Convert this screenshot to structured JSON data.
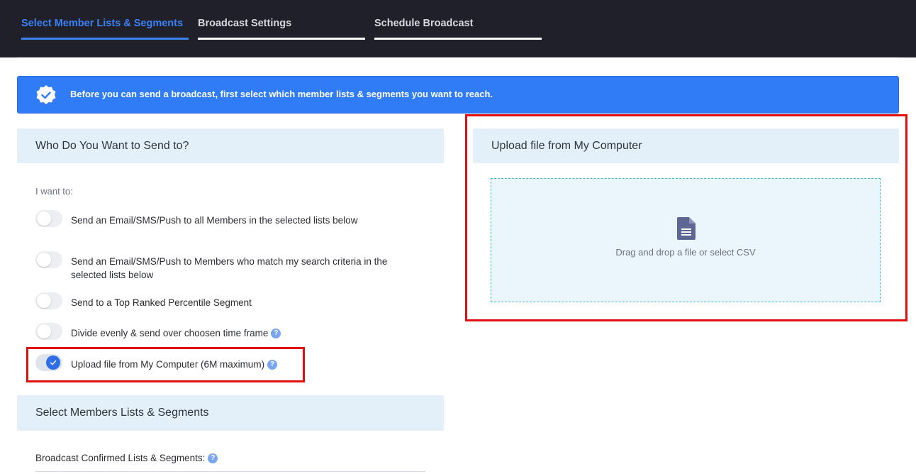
{
  "tabs": [
    {
      "label": "Select Member Lists & Segments",
      "active": true
    },
    {
      "label": "Broadcast Settings",
      "active": false
    },
    {
      "label": "Schedule Broadcast",
      "active": false
    }
  ],
  "banner": {
    "icon": "badge-check-icon",
    "text": "Before you can send a broadcast, first select which member lists & segments you want to reach."
  },
  "who": {
    "title": "Who Do You Want to Send to?",
    "intro": "I want to:",
    "options": [
      {
        "label": "Send an Email/SMS/Push to all Members in the selected lists below",
        "checked": false,
        "help": false
      },
      {
        "label": "Send an Email/SMS/Push to Members who match my search criteria in the selected lists below",
        "checked": false,
        "help": false
      },
      {
        "label": "Send to a Top Ranked Percentile Segment",
        "checked": false,
        "help": false
      },
      {
        "label": "Divide evenly & send over choosen time frame",
        "checked": false,
        "help": true
      },
      {
        "label": "Upload file from My Computer (6M maximum)",
        "checked": true,
        "help": true
      }
    ]
  },
  "help_glyph": "?",
  "select_members": {
    "title": "Select Members Lists & Segments",
    "confirmed_label": "Broadcast Confirmed Lists & Segments:"
  },
  "upload": {
    "title": "Upload file from My Computer",
    "icon": "file-icon",
    "drop_text": "Drag and drop a file or select CSV"
  },
  "colors": {
    "accent": "#3b82f6",
    "banner": "#2f7cf6",
    "highlight": "#e10f0f",
    "panel_header": "#e4f0f9",
    "topbar": "#1f2029"
  }
}
